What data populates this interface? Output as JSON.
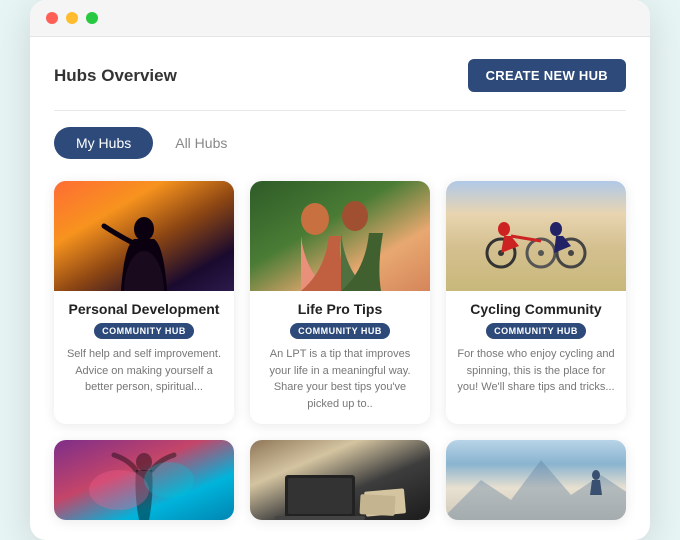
{
  "window": {
    "titlebar": {
      "dot1": "red",
      "dot2": "yellow",
      "dot3": "green"
    }
  },
  "header": {
    "title": "Hubs Overview",
    "create_button": "CREATE NEW HUB"
  },
  "tabs": [
    {
      "label": "My Hubs",
      "active": true
    },
    {
      "label": "All Hubs",
      "active": false
    }
  ],
  "cards": [
    {
      "title": "Personal Development",
      "badge": "COMMUNITY HUB",
      "description": "Self help and self improvement. Advice on making yourself a better person, spiritual...",
      "image_type": "personal"
    },
    {
      "title": "Life Pro Tips",
      "badge": "COMMUNITY HUB",
      "description": "An LPT is a tip that improves your life in a meaningful way. Share your best tips you've picked up to..",
      "image_type": "lifepro"
    },
    {
      "title": "Cycling Community",
      "badge": "COMMUNITY HUB",
      "description": "For those who enjoy cycling and spinning, this is the place for you! We'll share tips and tricks...",
      "image_type": "cycling"
    }
  ],
  "bottom_cards": [
    {
      "image_type": "bottom1"
    },
    {
      "image_type": "bottom2"
    },
    {
      "image_type": "bottom3"
    }
  ]
}
